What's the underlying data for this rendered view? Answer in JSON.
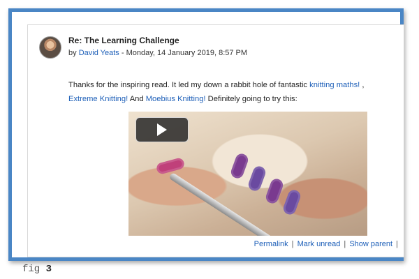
{
  "post": {
    "subject": "Re: The Learning Challenge",
    "by_prefix": "by",
    "author": "David Yeats",
    "date": "- Monday, 14 January 2019, 8:57 PM",
    "content": {
      "text1": "Thanks for the inspiring read.  It led my down a rabbit hole of fantastic",
      "link1": "knitting maths!",
      "text2": ",",
      "link2": "Extreme Knitting!",
      "text3": "And",
      "link3": "Moebius Knitting!",
      "text4": "Definitely going to try this:"
    },
    "video": {
      "play_icon": "play-icon"
    },
    "actions": {
      "permalink": "Permalink",
      "mark_unread": "Mark unread",
      "show_parent": "Show parent",
      "separator": "|"
    }
  },
  "caption": {
    "prefix": "fig",
    "number": "3"
  },
  "colors": {
    "frame": "#4a86c5",
    "link": "#1d5fb8"
  }
}
